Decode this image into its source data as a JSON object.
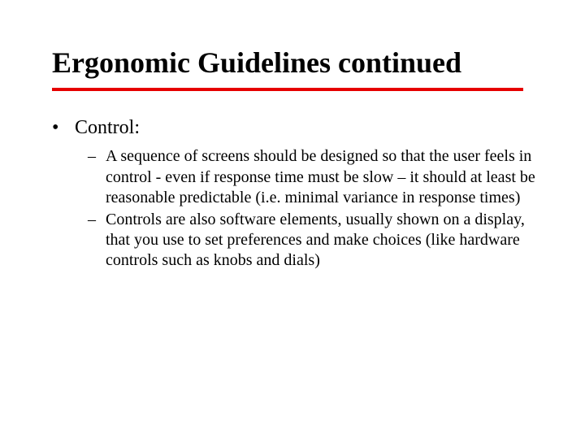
{
  "title": "Ergonomic Guidelines continued",
  "bullets": {
    "item0": {
      "label": "Control:",
      "sub0": "A sequence of screens should be designed so that the user feels in control - even if response time must be slow – it should at least be reasonable predictable (i.e. minimal variance in response times)",
      "sub1": "Controls are also software elements, usually shown on a display, that you use to set preferences and make choices (like hardware controls such as knobs and dials)"
    }
  },
  "colors": {
    "accent": "#e60000"
  }
}
